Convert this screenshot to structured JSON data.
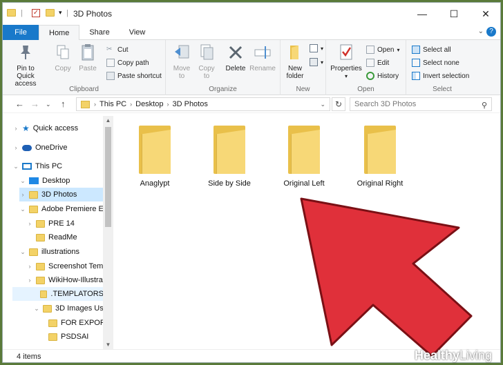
{
  "window": {
    "title": "3D Photos",
    "controls": {
      "minimize": "—",
      "maximize": "☐",
      "close": "✕"
    }
  },
  "tabs": [
    {
      "label": "File"
    },
    {
      "label": "Home"
    },
    {
      "label": "Share"
    },
    {
      "label": "View"
    }
  ],
  "ribbon": {
    "clipboard": {
      "label": "Clipboard",
      "pin": "Pin to Quick access",
      "pin_line1": "Pin to Quick",
      "pin_line2": "access",
      "copy": "Copy",
      "paste": "Paste",
      "cut": "Cut",
      "copy_path": "Copy path",
      "paste_shortcut": "Paste shortcut"
    },
    "organize": {
      "label": "Organize",
      "move_to_1": "Move",
      "move_to_2": "to",
      "copy_to_1": "Copy",
      "copy_to_2": "to",
      "delete": "Delete",
      "rename": "Rename"
    },
    "new": {
      "label": "New",
      "new_folder_1": "New",
      "new_folder_2": "folder"
    },
    "open": {
      "label": "Open",
      "properties": "Properties",
      "open": "Open",
      "edit": "Edit",
      "history": "History"
    },
    "select": {
      "label": "Select",
      "select_all": "Select all",
      "select_none": "Select none",
      "invert": "Invert selection"
    }
  },
  "address": {
    "crumbs": [
      "This PC",
      "Desktop",
      "3D Photos"
    ],
    "search_placeholder": "Search 3D Photos"
  },
  "nav_tree": [
    {
      "label": "Quick access"
    },
    {
      "label": "OneDrive"
    },
    {
      "label": "This PC"
    },
    {
      "label": "Desktop"
    },
    {
      "label": "3D Photos"
    },
    {
      "label": "Adobe Premiere El"
    },
    {
      "label": "PRE 14"
    },
    {
      "label": "ReadMe"
    },
    {
      "label": "illustrations"
    },
    {
      "label": "Screenshot Temp"
    },
    {
      "label": "WikiHow-Illustra"
    },
    {
      "label": ".TEMPLATORS"
    },
    {
      "label": "3D Images Usin"
    },
    {
      "label": "FOR EXPORT"
    },
    {
      "label": "PSDSAI"
    }
  ],
  "files": [
    {
      "name": "Anaglypt"
    },
    {
      "name": "Side by Side"
    },
    {
      "name": "Original Left"
    },
    {
      "name": "Original Right"
    }
  ],
  "status": {
    "item_count": "4 items"
  },
  "watermark": {
    "brand1": "Healthy",
    "brand2": "Living"
  },
  "colors": {
    "accent": "#1979ca",
    "arrow": "#e0303a",
    "folder": "#f7d877"
  }
}
